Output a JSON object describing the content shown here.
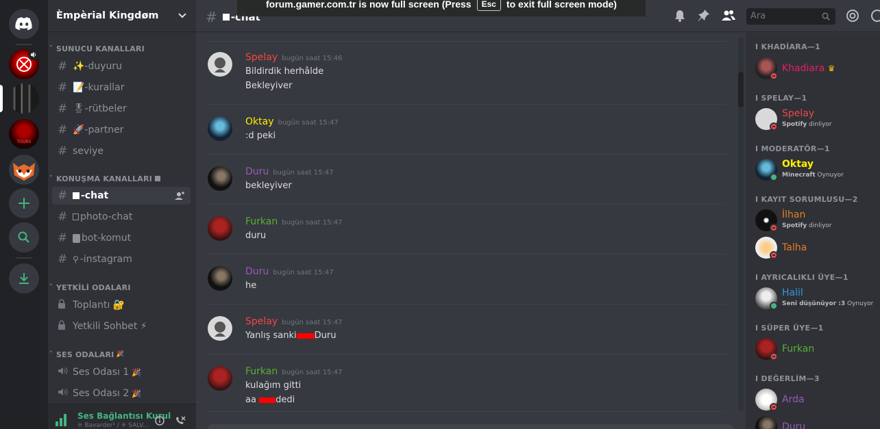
{
  "banner": {
    "text_before": "forum.gamer.com.tr is now full screen (Press",
    "key": "Esc",
    "text_after": "to exit full screen mode)"
  },
  "guild": {
    "name": "Èmpèrial Kingdøm"
  },
  "sidebar": {
    "categories": [
      {
        "label": "SUNUCU KANALLARI"
      },
      {
        "label": "KONUŞMA KANALLARI"
      },
      {
        "label": "YETKİLİ ODALARI"
      },
      {
        "label": "SES ODALARI"
      }
    ],
    "channels": [
      {
        "label": "✨-duyuru"
      },
      {
        "label": "📝-kurallar"
      },
      {
        "label": "🎖-rütbeler"
      },
      {
        "label": "🚀-partner"
      },
      {
        "label": "seviye"
      },
      {
        "label": "-chat"
      },
      {
        "label": "photo-chat"
      },
      {
        "label": "bot-komut"
      },
      {
        "label": "-instagram"
      },
      {
        "label": "Toplantı 🔐"
      },
      {
        "label": "Yetkili Sohbet ⚡"
      },
      {
        "label": "Ses Odası 1"
      },
      {
        "label": "Ses Odası 2"
      }
    ]
  },
  "voice": {
    "status": "Ses Bağlantısı Kurul",
    "detail": "⁜ Bavarder¹ / ⁜ SALV..."
  },
  "topbar": {
    "channel": "-chat",
    "search_placeholder": "Ara"
  },
  "messages": [
    {
      "author": "Spelay",
      "time": "bugün saat 15:46",
      "color": "#f04747",
      "lines": [
        "Bildirdik herhâlde",
        "Bekleyiver"
      ]
    },
    {
      "author": "Oktay",
      "time": "bugün saat 15:47",
      "color": "#fff000",
      "lines": [
        ":d peki"
      ]
    },
    {
      "author": "Duru",
      "time": "bugün saat 15:47",
      "color": "#9b59b6",
      "lines": [
        "bekleyiver"
      ]
    },
    {
      "author": "Furkan",
      "time": "bugün saat 15:47",
      "color": "#57b038",
      "lines": [
        "duru"
      ]
    },
    {
      "author": "Duru",
      "time": "bugün saat 15:47",
      "color": "#9b59b6",
      "lines": [
        "he"
      ]
    },
    {
      "author": "Spelay",
      "time": "bugün saat 15:47",
      "color": "#f04747",
      "lines_parts": {
        "a": "Yanlış sanki",
        "b": "Duru"
      }
    },
    {
      "author": "Furkan",
      "time": "bugün saat 15:47",
      "color": "#57b038",
      "lines": [
        "kulağım gitti"
      ],
      "line2_parts": {
        "a": "aa",
        "b": "dedi"
      }
    }
  ],
  "members": {
    "roles": [
      {
        "label": "I KHADİARA—1"
      },
      {
        "label": "I SPELAY—1"
      },
      {
        "label": "I MODERATÖR—1"
      },
      {
        "label": "I KAYIT SORUMLUSU—2"
      },
      {
        "label": "I AYRICALIKLI ÜYE—1"
      },
      {
        "label": "I SÜPER ÜYE—1"
      },
      {
        "label": "I DEĞERLİM—3"
      }
    ],
    "list": [
      {
        "name": "Khadiara",
        "color": "#e91e63",
        "status": "dnd"
      },
      {
        "name": "Spelay",
        "color": "#f04747",
        "status": "dnd",
        "activity_app": "Spotify",
        "activity_verb": "dinliyor"
      },
      {
        "name": "Oktay",
        "color": "#fff000",
        "status": "online",
        "activity_app": "Minecraft",
        "activity_verb": "Oynuyor"
      },
      {
        "name": "İlhan",
        "color": "#e67e22",
        "status": "dnd",
        "activity_app": "Spotify",
        "activity_verb": "dinliyor"
      },
      {
        "name": "Talha",
        "color": "#e67e22",
        "status": "dnd"
      },
      {
        "name": "Halil",
        "color": "#3498db",
        "status": "online",
        "activity_app": "Seni düşünüyor :3",
        "activity_verb": "Oynuyor"
      },
      {
        "name": "Furkan",
        "color": "#57b038",
        "status": "dnd"
      },
      {
        "name": "Arda",
        "color": "#9b59b6",
        "status": "dnd"
      },
      {
        "name": "Duru",
        "color": "#9b59b6",
        "status": "dnd"
      }
    ]
  }
}
